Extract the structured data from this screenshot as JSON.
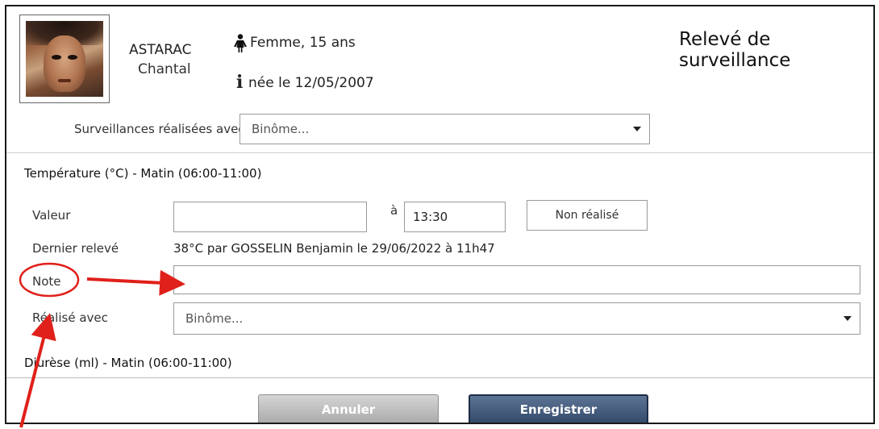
{
  "patient": {
    "last_name": "ASTARAC",
    "first_name": "Chantal",
    "gender_age": "Femme, 15 ans",
    "birth": "née le 12/05/2007"
  },
  "page": {
    "title": "Relevé de surveillance"
  },
  "surveillance": {
    "label": "Surveillances réalisées avec",
    "select_value": "Binôme..."
  },
  "temperature": {
    "section_title": "Température (°C) - Matin (06:00-11:00)",
    "value_label": "Valeur",
    "value_input": "",
    "at_label": "à",
    "time_value": "13:30",
    "not_done_button": "Non réalisé",
    "last_label": "Dernier relevé",
    "last_value": "38°C par GOSSELIN Benjamin le 29/06/2022 à 11h47",
    "note_label": "Note",
    "note_input": "",
    "done_with_label": "Réalisé avec",
    "done_with_value": "Binôme..."
  },
  "diurese": {
    "section_title": "Diurèse (ml) - Matin (06:00-11:00)"
  },
  "footer": {
    "cancel_label": "Annuler",
    "save_label": "Enregistrer"
  },
  "colors": {
    "annotation": "#e0201a",
    "save_button": "#3d5373",
    "cancel_button": "#bdbdbd"
  },
  "icons": {
    "gender": "female-person-icon",
    "info": "info-icon",
    "dropdown": "chevron-down-icon"
  }
}
